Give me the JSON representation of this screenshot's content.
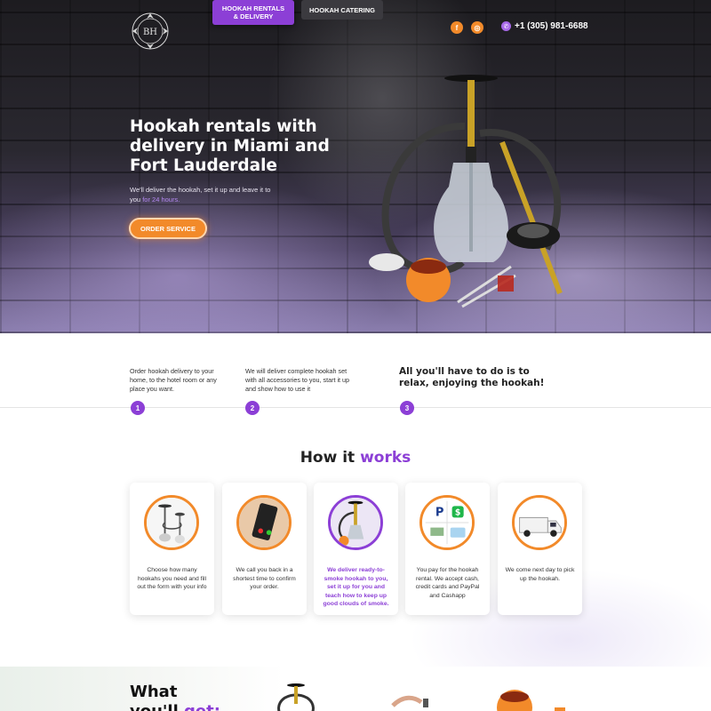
{
  "header": {
    "nav": [
      {
        "label_line1": "HOOKAH RENTALS",
        "label_line2": "& DELIVERY"
      },
      {
        "label": "HOOKAH CATERING"
      }
    ],
    "social": {
      "facebook": "f",
      "instagram": "◎"
    },
    "phone": "+1 (305) 981-6688"
  },
  "hero": {
    "title": "Hookah rentals with delivery in Miami and Fort Lauderdale",
    "subtitle_pre": "We'll deliver the hookah, set it up and leave it to you ",
    "subtitle_highlight": "for 24 hours.",
    "cta": "ORDER SERVICE"
  },
  "steps": [
    {
      "number": "1",
      "text": "Order hookah delivery to your home, to the hotel room or any place you want."
    },
    {
      "number": "2",
      "text": "We will deliver complete hookah set with all accessories to you, start it up and show how to use it"
    },
    {
      "number": "3",
      "text": "All you'll have to do is to relax, enjoying the hookah!"
    }
  ],
  "how": {
    "title_pre": "How it ",
    "title_accent": "works",
    "cards": [
      {
        "icon": "hookah-icon",
        "text": "Choose how many hookahs you need and fill out the form with your info"
      },
      {
        "icon": "phone-call-icon",
        "text": "We call you back in a shortest time to confirm your order."
      },
      {
        "icon": "hookah-smoke-icon",
        "text": "We deliver ready-to-smoke hookah to you, set it up for you and teach how to keep up good clouds of smoke."
      },
      {
        "icon": "payment-icon",
        "text": "You pay for the hookah rental. We accept cash, credit cards and PayPal and Cashapp"
      },
      {
        "icon": "delivery-van-icon",
        "text": "We come next day to pick up the hookah."
      }
    ]
  },
  "get": {
    "title_line1": "What",
    "title_line2_pre": "you'll ",
    "title_line2_accent": "get:"
  },
  "colors": {
    "accent": "#8c3fd6",
    "orange": "#f28a2a"
  }
}
